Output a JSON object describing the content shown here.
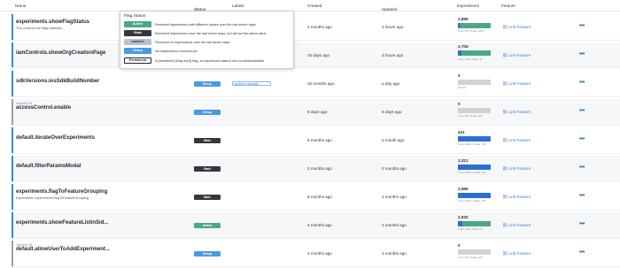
{
  "header": {
    "name": "Name",
    "status": "Status",
    "labels": "Labels",
    "created": "Created",
    "updated": "Updated",
    "impressions": "Impressions",
    "feature": "Feature"
  },
  "tooltip": {
    "title": "Flag Status",
    "items": [
      {
        "badge": "Active",
        "desc": "Received impressions with different values over the last seven days"
      },
      {
        "badge": "Stale",
        "desc": "Received impressions over the last seven days, but all had the same value"
      },
      {
        "badge": "Inactive",
        "desc": "Received no impressions over the last seven days"
      },
      {
        "badge": "Setup",
        "desc": "No impressions received yet"
      },
      {
        "badge": "Permanent",
        "desc": "A permanent (long lived) flag, so impression data is not counted/available"
      }
    ]
  },
  "colors": {
    "accent": "#2d8fe0",
    "active": "#4aa88a",
    "stale": "#33383f",
    "inactive": "#b9c2cc",
    "setup": "#4a9ae0",
    "true_fill": "#4aa88a",
    "false_fill": "#2d6fd0",
    "link": "#3d7bd8"
  },
  "rows": [
    {
      "targeting": "",
      "name": "experiments.showFlagStatus",
      "desc": "This controls the flags statuses",
      "status": "",
      "label": "",
      "created": "2 months ago",
      "updated": "2 hours ago",
      "impressions": "2,899",
      "true_pct": 5,
      "false_pct": 95,
      "impr_meta": "True: 5% | False: 95%",
      "link": "Link Feature",
      "more": "•••"
    },
    {
      "targeting": "",
      "name": "iamControls.showOrgCreationPage",
      "desc": "",
      "status": "",
      "label": "",
      "created": "10 days ago",
      "updated": "3 hours ago",
      "impressions": "2,704",
      "true_pct": 11,
      "false_pct": 89,
      "impr_meta": "True: 11% | False: 8...",
      "link": "Link Feature",
      "more": "•••"
    },
    {
      "targeting": "",
      "name": "sdkVersions.iosSdkBuildNumber",
      "desc": "",
      "status": "Setup",
      "label": "backend-compatib...",
      "created": "10 months ago",
      "updated": "a day ago",
      "impressions": "0",
      "true_pct": 0,
      "false_pct": 0,
      "impr_meta": "0/0 0%",
      "link": "Link Feature",
      "more": "•••"
    },
    {
      "targeting": "Targeting Off",
      "name": "accessControl.enable",
      "desc": "",
      "status": "Setup",
      "label": "",
      "created": "6 days ago",
      "updated": "6 days ago",
      "impressions": "0",
      "true_pct": 0,
      "false_pct": 0,
      "impr_meta": "True: 0% | False: 0%",
      "link": "Link Feature",
      "more": "•••"
    },
    {
      "targeting": "",
      "name": "default.iterateOverExperiments",
      "desc": "",
      "status": "Stale",
      "label": "",
      "created": "8 months ago",
      "updated": "a month ago",
      "impressions": "431",
      "true_pct": 100,
      "false_pct": 0,
      "impr_meta": "True: 100% | False: 0%",
      "link": "Link Feature",
      "more": "•••"
    },
    {
      "targeting": "",
      "name": "default.filterParamsModal",
      "desc": "",
      "status": "Stale",
      "label": "",
      "created": "2 months ago",
      "updated": "2 months ago",
      "impressions": "2,321",
      "true_pct": 100,
      "false_pct": 0,
      "impr_meta": "True: 100% | False: 0%",
      "link": "Link Feature",
      "more": "•••"
    },
    {
      "targeting": "",
      "name": "experiments.flagToFeatureGrouping",
      "desc": "Experiment: experiments.flagToFeatureGrouping",
      "status": "Stale",
      "label": "",
      "created": "6 months ago",
      "updated": "2 months ago",
      "impressions": "2,565",
      "true_pct": 100,
      "false_pct": 0,
      "impr_meta": "True: 100% | False: 0%",
      "link": "Link Feature",
      "more": "•••"
    },
    {
      "targeting": "",
      "name": "experiments.showFeatureListinSid...",
      "desc": "",
      "status": "Active",
      "label": "",
      "created": "4 months ago",
      "updated": "4 months ago",
      "impressions": "2,932",
      "true_pct": 14,
      "false_pct": 86,
      "impr_meta": "True: 14% | False: 8...",
      "link": "Link Feature",
      "more": "•••"
    },
    {
      "targeting": "Targeting Off",
      "name": "default.allowUserToAddExperiment...",
      "desc": "",
      "status": "Setup",
      "label": "",
      "created": "4 months ago",
      "updated": "4 months ago",
      "impressions": "0",
      "true_pct": 0,
      "false_pct": 0,
      "impr_meta": "True: 0% | False: 0%",
      "link": "Link Feature",
      "more": "•••"
    }
  ]
}
